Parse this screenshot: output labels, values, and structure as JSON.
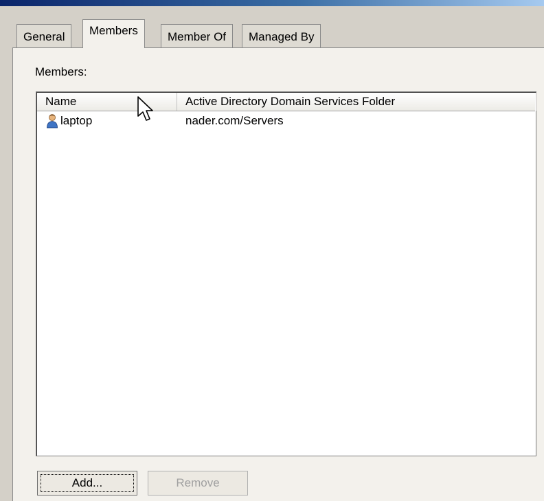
{
  "tabs": [
    {
      "label": "General",
      "active": false
    },
    {
      "label": "Members",
      "active": true
    },
    {
      "label": "Member Of",
      "active": false
    },
    {
      "label": "Managed By",
      "active": false
    }
  ],
  "members_label": "Members:",
  "list": {
    "columns": [
      "Name",
      "Active Directory Domain Services Folder"
    ],
    "rows": [
      {
        "icon": "user-icon",
        "name": "laptop",
        "folder": "nader.com/Servers"
      }
    ]
  },
  "buttons": {
    "add_label": "Add...",
    "remove_label": "Remove",
    "remove_enabled": false
  },
  "colors": {
    "title_gradient_start": "#0a246a",
    "panel_background": "#f3f1ec",
    "dialog_background": "#d4d0c8"
  }
}
